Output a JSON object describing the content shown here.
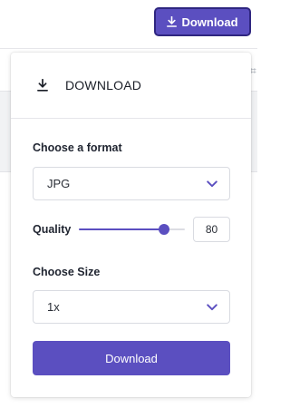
{
  "topbar": {
    "download_button_label": "Download",
    "download_icon": "download-icon"
  },
  "panel": {
    "title": "DOWNLOAD",
    "title_icon": "download-icon",
    "format": {
      "label": "Choose a format",
      "selected": "JPG",
      "icon": "chevron-down-icon"
    },
    "quality": {
      "label": "Quality",
      "value": "80",
      "slider_fraction": 0.8
    },
    "size": {
      "label": "Choose Size",
      "selected": "1x",
      "icon": "chevron-down-icon"
    },
    "download_button_label": "Download"
  },
  "colors": {
    "accent": "#5b4fc0",
    "accent_border": "#2f2680"
  }
}
